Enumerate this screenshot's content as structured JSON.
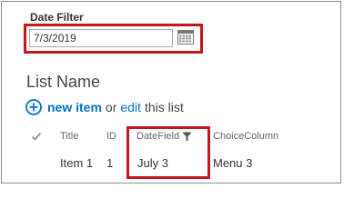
{
  "date_filter": {
    "title": "Date Filter",
    "value": "7/3/2019",
    "calendar_icon": "calendar-icon"
  },
  "list": {
    "title": "List Name",
    "new_item_label": "new item",
    "or_text": "or",
    "edit_label": "edit",
    "rest_text": "this list",
    "columns": [
      {
        "label": "Title"
      },
      {
        "label": "ID"
      },
      {
        "label": "DateField",
        "icon": "filter-icon"
      },
      {
        "label": "ChoiceColumn"
      }
    ],
    "rows": [
      {
        "title": "Item 1",
        "id": "1",
        "date": "July 3",
        "choice": "Menu 3"
      }
    ]
  },
  "colors": {
    "link": "#0072c6",
    "highlight": "#c4161c",
    "text": "#444444"
  }
}
